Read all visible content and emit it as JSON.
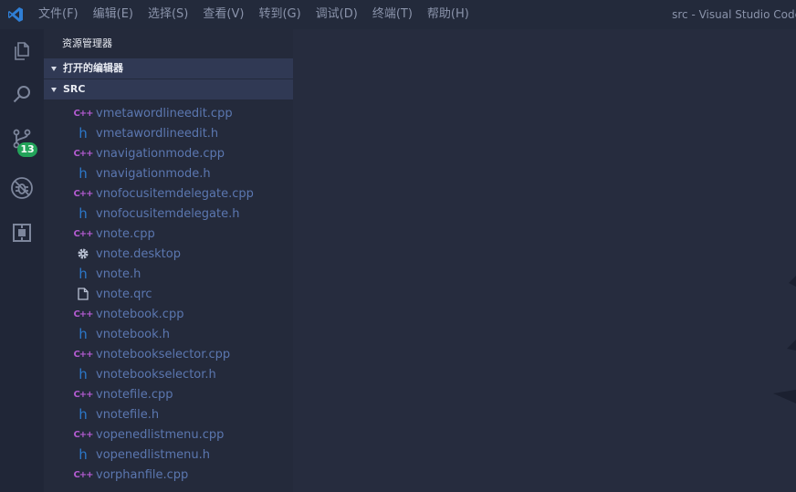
{
  "titlebar": {
    "menu": [
      "文件(F)",
      "编辑(E)",
      "选择(S)",
      "查看(V)",
      "转到(G)",
      "调试(D)",
      "终端(T)",
      "帮助(H)"
    ],
    "window_title": "src - Visual Studio Code"
  },
  "activitybar": {
    "items": [
      "files-icon",
      "search-icon",
      "source-control-icon",
      "debug-icon",
      "extensions-icon"
    ],
    "scm_badge": "13"
  },
  "sidebar": {
    "title": "资源管理器",
    "open_editors_label": "打开的编辑器",
    "folder_label": "SRC",
    "files": [
      {
        "name": "vmetawordlineedit.cpp",
        "icon": "cpp"
      },
      {
        "name": "vmetawordlineedit.h",
        "icon": "h"
      },
      {
        "name": "vnavigationmode.cpp",
        "icon": "cpp"
      },
      {
        "name": "vnavigationmode.h",
        "icon": "h"
      },
      {
        "name": "vnofocusitemdelegate.cpp",
        "icon": "cpp"
      },
      {
        "name": "vnofocusitemdelegate.h",
        "icon": "h"
      },
      {
        "name": "vnote.cpp",
        "icon": "cpp"
      },
      {
        "name": "vnote.desktop",
        "icon": "gear"
      },
      {
        "name": "vnote.h",
        "icon": "h"
      },
      {
        "name": "vnote.qrc",
        "icon": "file"
      },
      {
        "name": "vnotebook.cpp",
        "icon": "cpp"
      },
      {
        "name": "vnotebook.h",
        "icon": "h"
      },
      {
        "name": "vnotebookselector.cpp",
        "icon": "cpp"
      },
      {
        "name": "vnotebookselector.h",
        "icon": "h"
      },
      {
        "name": "vnotefile.cpp",
        "icon": "cpp"
      },
      {
        "name": "vnotefile.h",
        "icon": "h"
      },
      {
        "name": "vopenedlistmenu.cpp",
        "icon": "cpp"
      },
      {
        "name": "vopenedlistmenu.h",
        "icon": "h"
      },
      {
        "name": "vorphanfile.cpp",
        "icon": "cpp"
      }
    ]
  },
  "colors": {
    "background": "#262c3e",
    "sidebar": "#242a3b",
    "section_header": "#303954",
    "file_text": "#5b77b0",
    "cpp_icon": "#b35bd0",
    "h_icon": "#2c78c9",
    "badge": "#23a35a",
    "vscode_blue": "#2f7fd6"
  }
}
